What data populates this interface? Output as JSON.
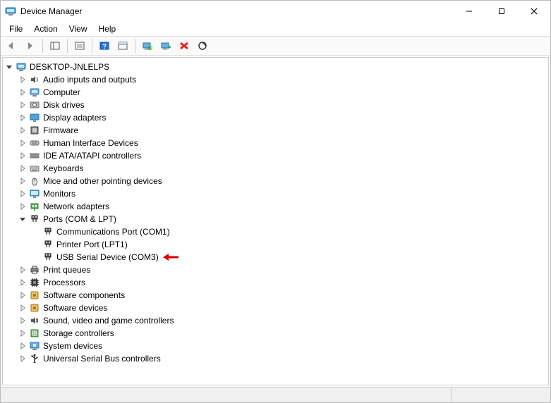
{
  "title": "Device Manager",
  "menu": [
    "File",
    "Action",
    "View",
    "Help"
  ],
  "toolbar": [
    {
      "name": "back-icon"
    },
    {
      "name": "forward-icon"
    },
    {
      "sep": true
    },
    {
      "name": "show-hide-tree-icon"
    },
    {
      "sep": true
    },
    {
      "name": "properties-icon"
    },
    {
      "sep": true
    },
    {
      "name": "help-icon"
    },
    {
      "name": "action-bar-icon"
    },
    {
      "sep": true
    },
    {
      "name": "update-driver-icon"
    },
    {
      "name": "uninstall-device-icon"
    },
    {
      "name": "disable-device-icon"
    },
    {
      "name": "scan-hardware-icon"
    }
  ],
  "tree": {
    "root": {
      "label": "DESKTOP-JNLELPS",
      "icon": "computer-icon",
      "expanded": true,
      "children": [
        {
          "label": "Audio inputs and outputs",
          "icon": "audio-icon"
        },
        {
          "label": "Computer",
          "icon": "computer-icon"
        },
        {
          "label": "Disk drives",
          "icon": "disk-icon"
        },
        {
          "label": "Display adapters",
          "icon": "display-icon"
        },
        {
          "label": "Firmware",
          "icon": "firmware-icon"
        },
        {
          "label": "Human Interface Devices",
          "icon": "hid-icon"
        },
        {
          "label": "IDE ATA/ATAPI controllers",
          "icon": "ide-icon"
        },
        {
          "label": "Keyboards",
          "icon": "keyboard-icon"
        },
        {
          "label": "Mice and other pointing devices",
          "icon": "mouse-icon"
        },
        {
          "label": "Monitors",
          "icon": "monitor-icon"
        },
        {
          "label": "Network adapters",
          "icon": "network-icon"
        },
        {
          "label": "Ports (COM & LPT)",
          "icon": "port-icon",
          "expanded": true,
          "children": [
            {
              "label": "Communications Port (COM1)",
              "icon": "port-icon",
              "leaf": true
            },
            {
              "label": "Printer Port (LPT1)",
              "icon": "port-icon",
              "leaf": true
            },
            {
              "label": "USB Serial Device (COM3)",
              "icon": "port-icon",
              "leaf": true,
              "annotated": true
            }
          ]
        },
        {
          "label": "Print queues",
          "icon": "printer-icon"
        },
        {
          "label": "Processors",
          "icon": "cpu-icon"
        },
        {
          "label": "Software components",
          "icon": "software-icon"
        },
        {
          "label": "Software devices",
          "icon": "software-icon"
        },
        {
          "label": "Sound, video and game controllers",
          "icon": "sound-icon"
        },
        {
          "label": "Storage controllers",
          "icon": "storage-icon"
        },
        {
          "label": "System devices",
          "icon": "system-icon"
        },
        {
          "label": "Universal Serial Bus controllers",
          "icon": "usb-icon"
        }
      ]
    }
  }
}
